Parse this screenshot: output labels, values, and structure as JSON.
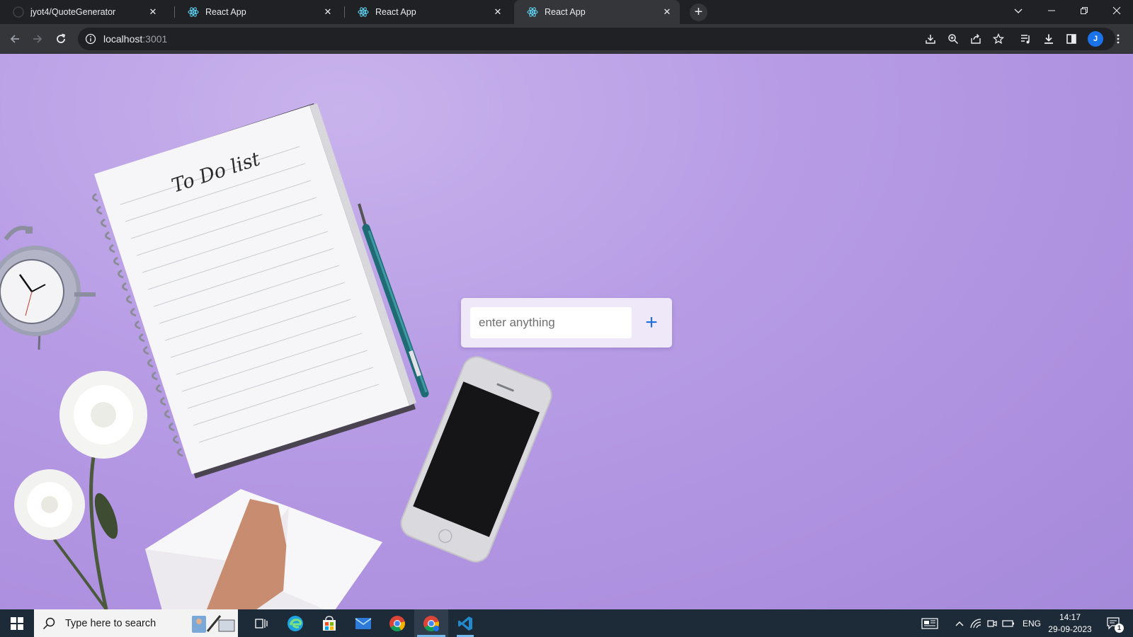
{
  "browser": {
    "tabs": [
      {
        "title": "jyot4/QuoteGenerator",
        "icon": "github-icon",
        "active": false
      },
      {
        "title": "React App",
        "icon": "react-icon",
        "active": false
      },
      {
        "title": "React App",
        "icon": "react-icon",
        "active": false
      },
      {
        "title": "React App",
        "icon": "react-icon",
        "active": true
      }
    ],
    "address": {
      "host": "localhost",
      "port": ":3001"
    },
    "profile_initial": "J"
  },
  "page": {
    "notebook_heading": "To Do list",
    "todo_input": {
      "placeholder": "enter anything",
      "value": ""
    },
    "add_button_label": "+"
  },
  "taskbar": {
    "search_placeholder": "Type here to search",
    "language": "ENG",
    "time": "14:17",
    "date": "29-09-2023",
    "notification_count": "1"
  },
  "colors": {
    "background_purple": "#b79ce5",
    "accent_blue": "#1f6fe0",
    "taskbar": "#1d2a38",
    "browser_toolbar": "#35363a"
  }
}
